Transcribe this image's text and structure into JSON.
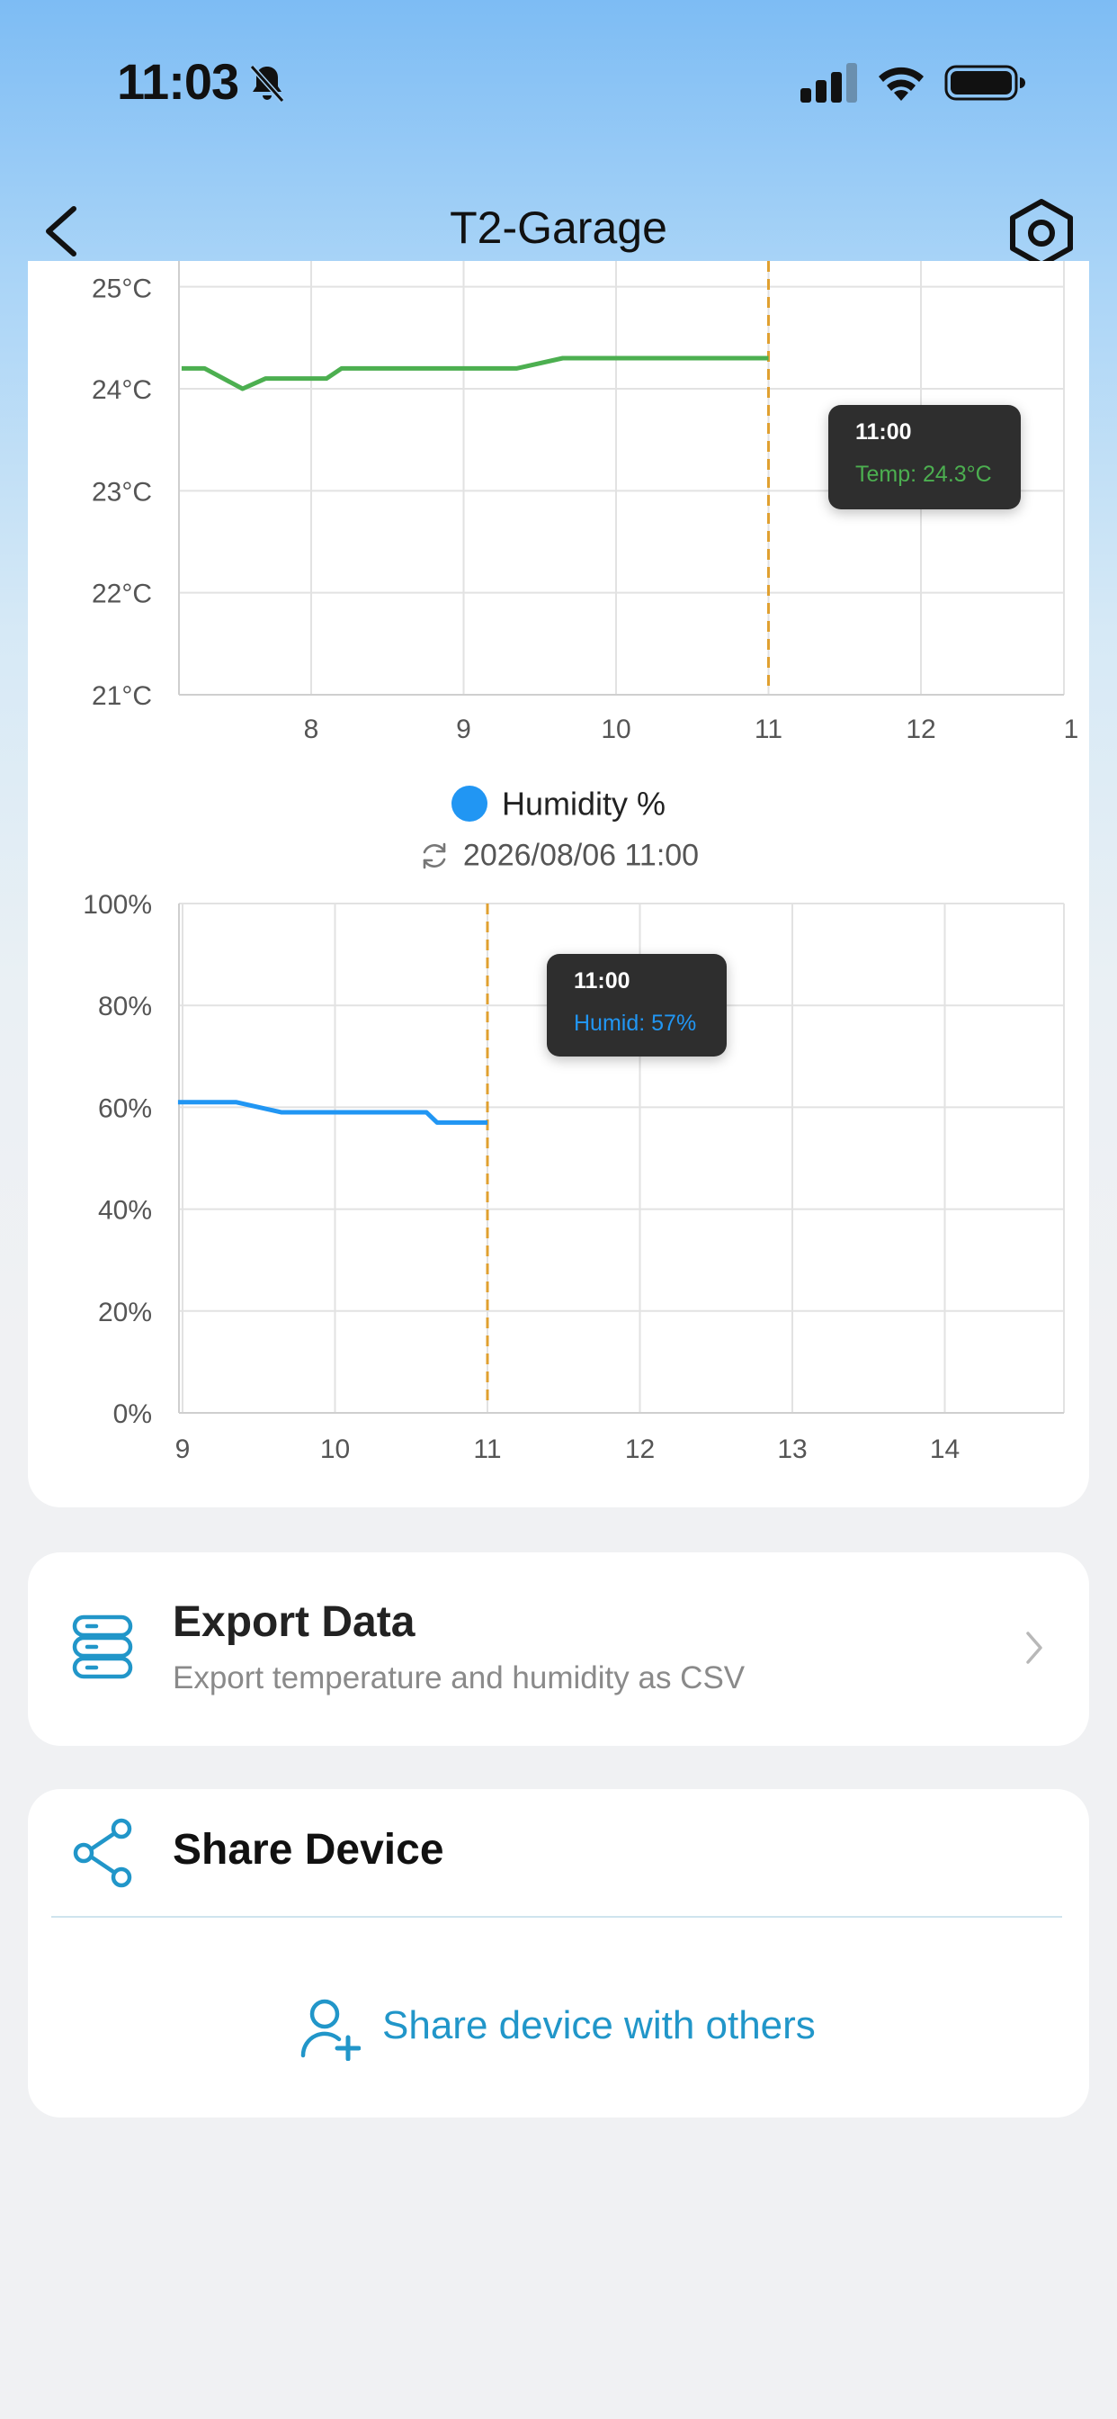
{
  "status_bar": {
    "time": "11:03",
    "icons": [
      "bell-slash-icon",
      "cellular-signal-icon",
      "wifi-icon",
      "battery-icon"
    ]
  },
  "nav": {
    "title": "T2-Garage",
    "back_icon": "chevron-left-icon",
    "settings_icon": "hexagon-gear-icon"
  },
  "chart_data": [
    {
      "type": "line",
      "title": "",
      "y_tick_labels": [
        "24°C",
        "23°C",
        "22°C",
        "21°C"
      ],
      "y_top_partial_label": "25°C",
      "x_tick_labels": [
        "8",
        "9",
        "10",
        "11",
        "12",
        "1"
      ],
      "ylim": [
        21,
        25
      ],
      "xlim": [
        7.15,
        12.95
      ],
      "series": [
        {
          "color": "#4caf50",
          "x": [
            7.15,
            7.3,
            7.55,
            7.7,
            8.0,
            8.1,
            8.2,
            9.0,
            9.35,
            9.65,
            10.0,
            11.0
          ],
          "y": [
            24.2,
            24.2,
            24.0,
            24.1,
            24.1,
            24.1,
            24.2,
            24.2,
            24.2,
            24.3,
            24.3,
            24.3
          ]
        }
      ],
      "cursor_x": 11,
      "tooltip": {
        "time": "11:00",
        "text": "Temp: 24.3°C"
      }
    },
    {
      "type": "line",
      "legend": {
        "label": "Humidity %",
        "color": "#2196f3"
      },
      "updated": "2026/08/06 11:00",
      "y_tick_labels": [
        "100%",
        "80%",
        "60%",
        "40%",
        "20%",
        "0%"
      ],
      "x_tick_labels": [
        "9",
        "10",
        "11",
        "12",
        "13",
        "14"
      ],
      "ylim": [
        0,
        100
      ],
      "xlim": [
        8.97,
        14.78
      ],
      "series": [
        {
          "name": "Humidity %",
          "color": "#2196f3",
          "x": [
            8.97,
            9.35,
            9.65,
            10.0,
            10.6,
            10.67,
            11.0
          ],
          "y": [
            61,
            61,
            59,
            59,
            59,
            57,
            57
          ]
        }
      ],
      "cursor_x": 11,
      "tooltip": {
        "time": "11:00",
        "text": "Humid: 57%"
      }
    }
  ],
  "export": {
    "title": "Export Data",
    "subtitle": "Export temperature and humidity as CSV",
    "icon": "database-icon"
  },
  "share": {
    "title": "Share Device",
    "button_label": "Share device with others",
    "icon": "share-icon",
    "button_icon": "add-user-icon"
  },
  "colors": {
    "accent": "#2196c9",
    "temperature": "#4caf50",
    "humidity": "#2196f3",
    "cursor": "#e0a030"
  }
}
